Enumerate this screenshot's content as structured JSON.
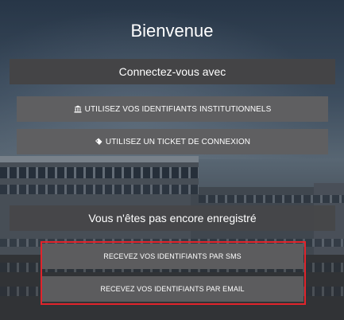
{
  "page": {
    "title": "Bienvenue"
  },
  "connect_section": {
    "header": "Connectez-vous avec",
    "buttons": [
      {
        "label": "UTILISEZ VOS IDENTIFIANTS INSTITUTIONNELS",
        "icon": "institution-icon"
      },
      {
        "label": "UTILISEZ UN TICKET DE CONNEXION",
        "icon": "ticket-icon"
      }
    ]
  },
  "register_section": {
    "header": "Vous n'êtes pas encore enregistré",
    "buttons": [
      {
        "label": "RECEVEZ VOS IDENTIFIANTS PAR SMS"
      },
      {
        "label": "RECEVEZ VOS IDENTIFIANTS PAR EMAIL"
      }
    ]
  },
  "colors": {
    "highlight_border": "#e1242b",
    "button_bg": "#5f5f61",
    "header_bg": "#444446",
    "text": "#ffffff"
  }
}
